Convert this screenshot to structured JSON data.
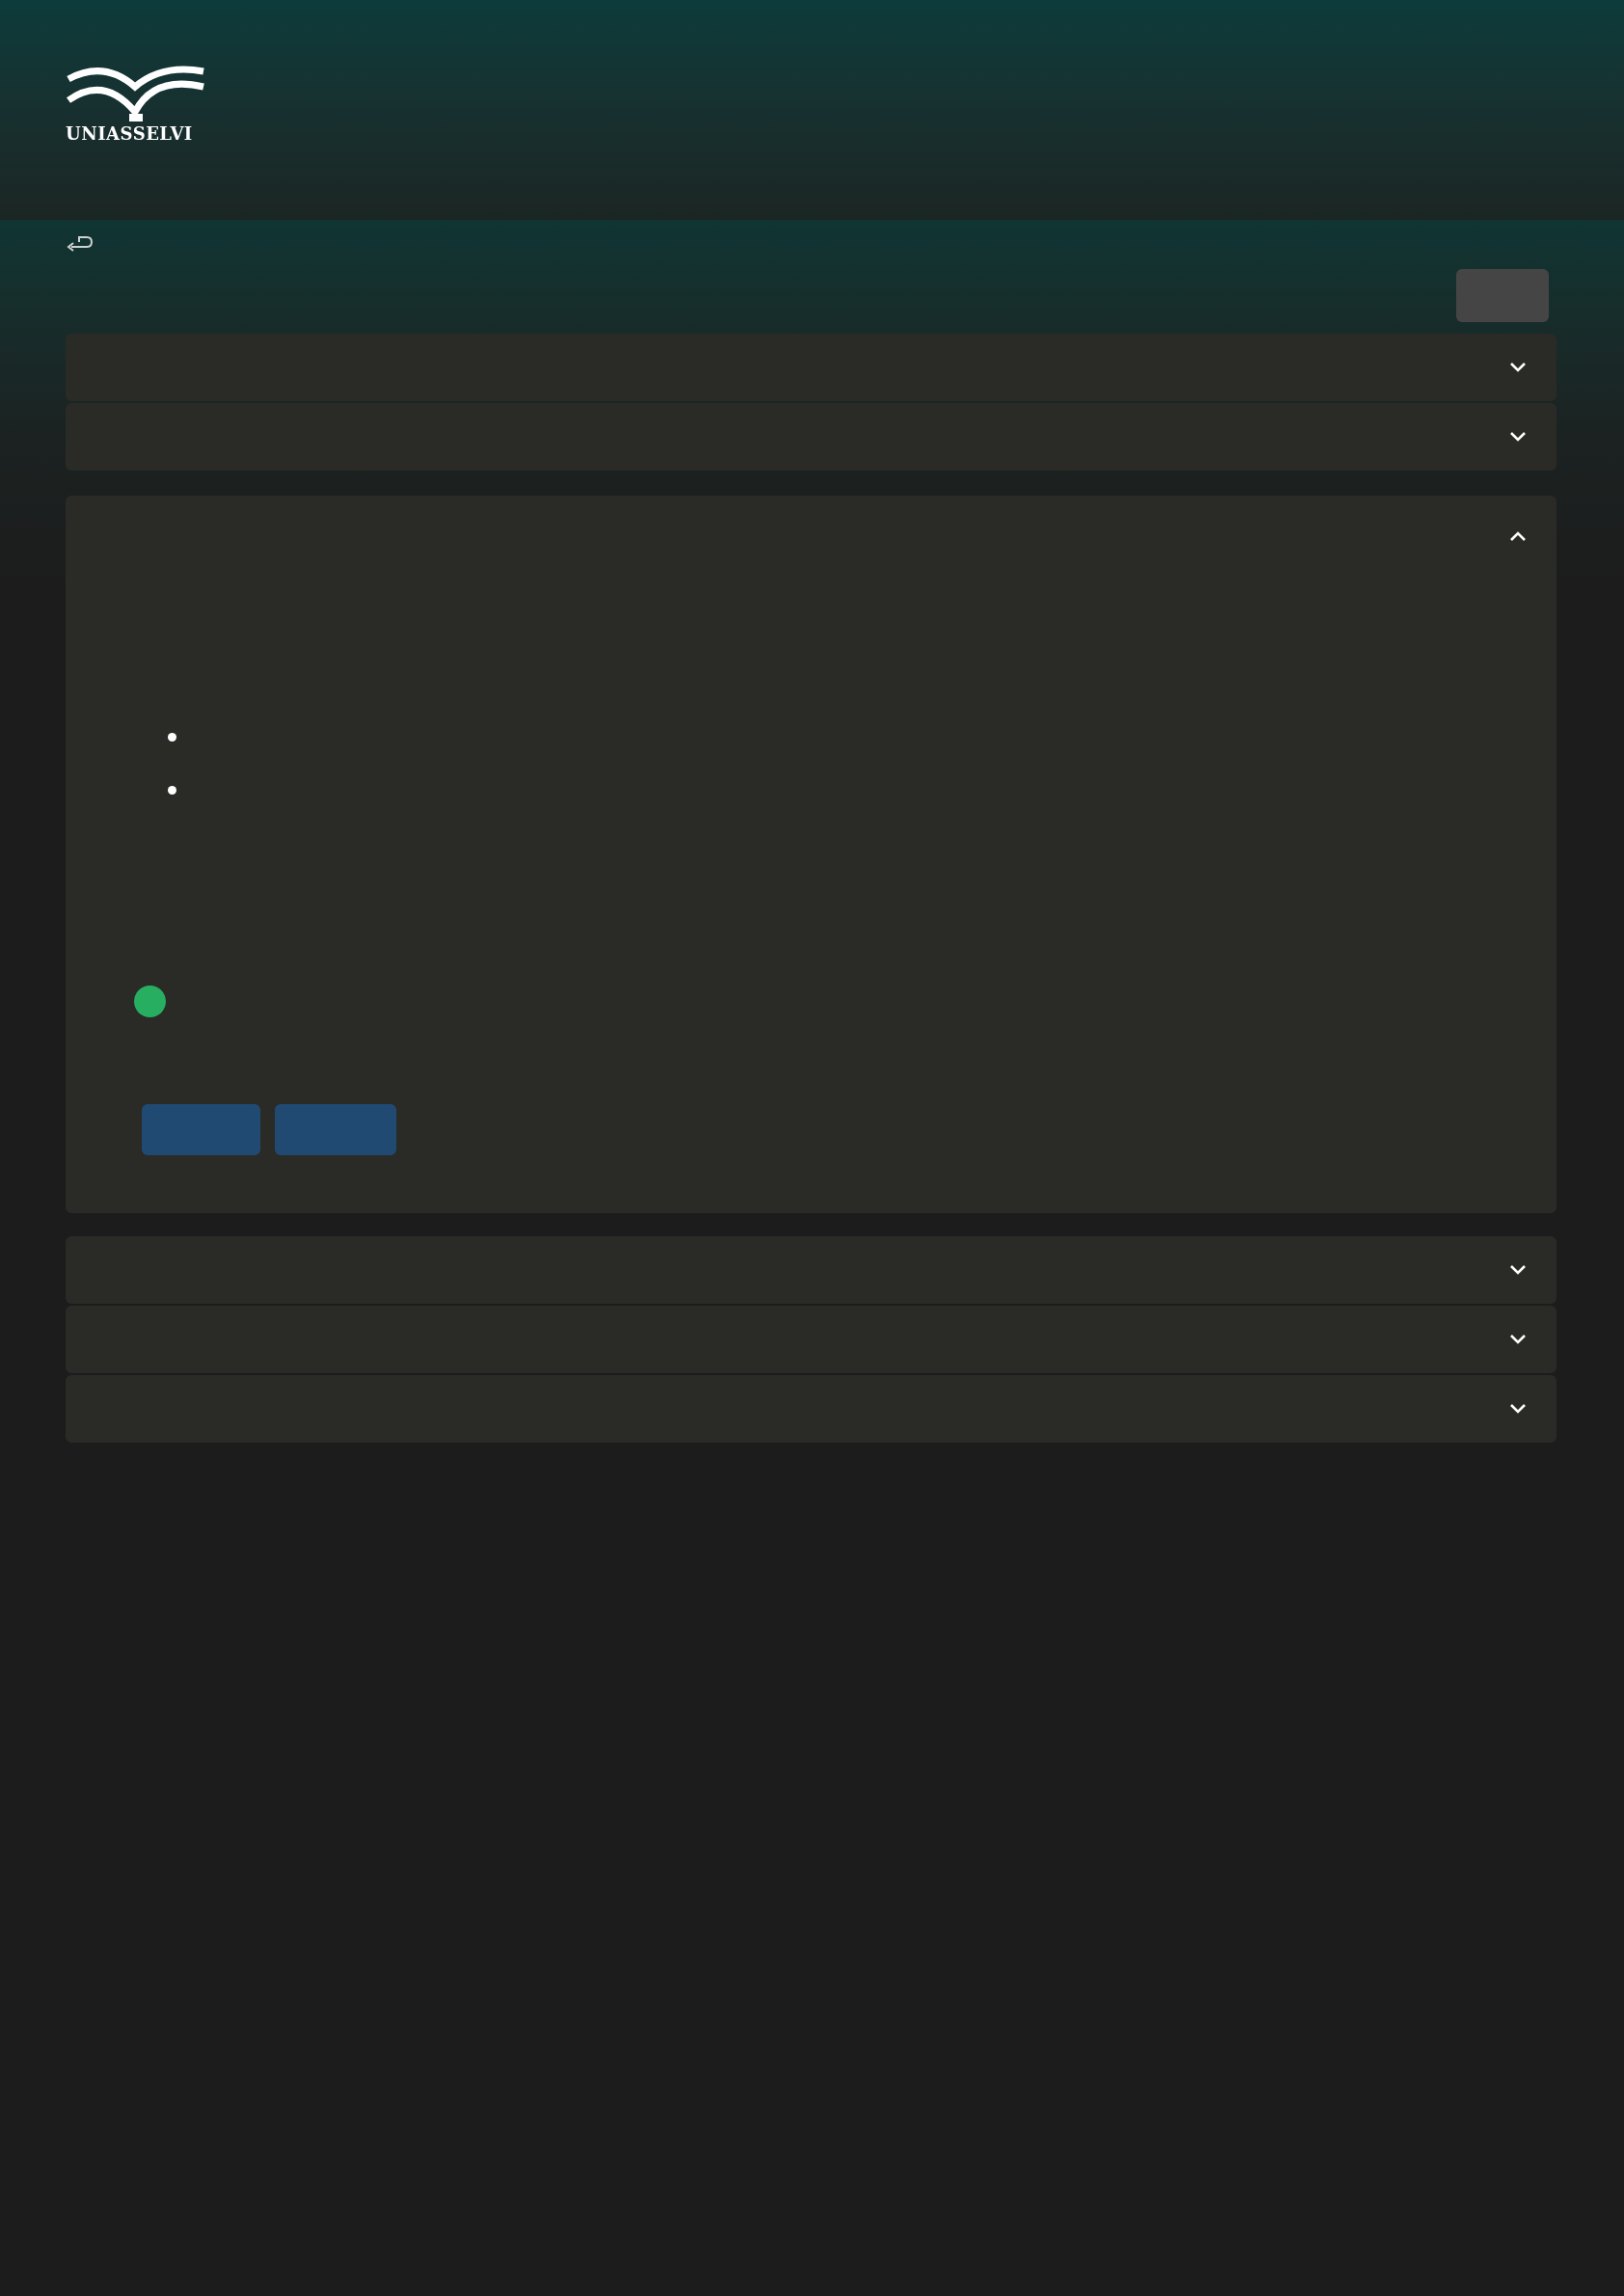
{
  "header": {
    "logo_text": "UNIASSELVI"
  },
  "sections": [
    {
      "expanded": false
    },
    {
      "expanded": false
    },
    {
      "expanded": true
    },
    {
      "expanded": false
    },
    {
      "expanded": false
    },
    {
      "expanded": false
    }
  ]
}
